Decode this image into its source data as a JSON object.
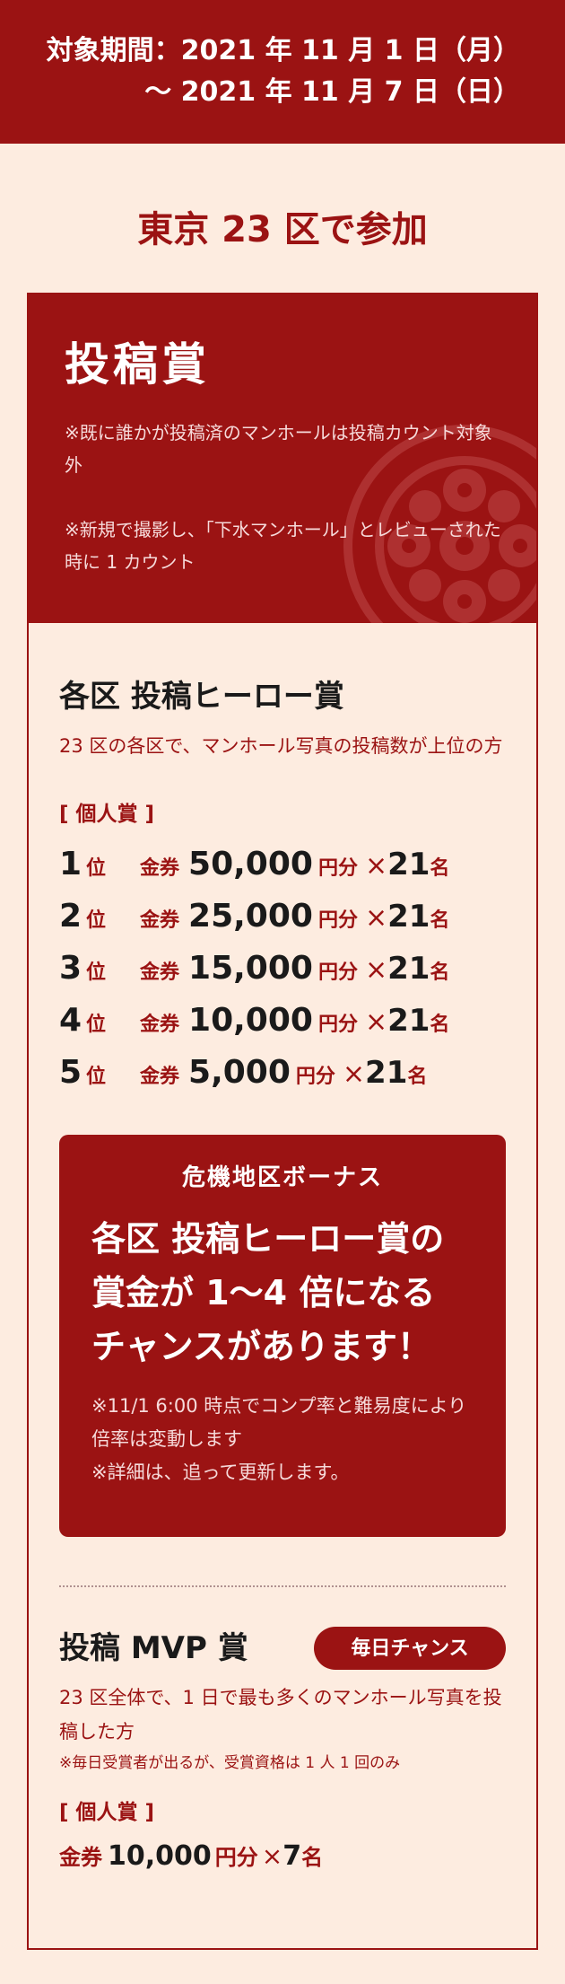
{
  "period": {
    "line1": "対象期間：2021 年 11 月 1 日（月）",
    "line2": "〜 2021 年 11 月 7 日（日）"
  },
  "region_title": "東京 23 区で参加",
  "card": {
    "title": "投稿賞",
    "notes": [
      "※既に誰かが投稿済のマンホールは投稿カウント対象外",
      "※新規で撮影し、「下水マンホール」とレビューされた時に 1 カウント"
    ]
  },
  "hero": {
    "title": "各区 投稿ヒーロー賞",
    "desc": "23 区の各区で、マンホール写真の投稿数が上位の方",
    "kind": "[ 個人賞 ]",
    "ranks": [
      {
        "num": "1",
        "pos": "位",
        "kin": "金券",
        "amount": "50,000",
        "unit": "円分",
        "x": "×",
        "count": "21",
        "mei": "名"
      },
      {
        "num": "2",
        "pos": "位",
        "kin": "金券",
        "amount": "25,000",
        "unit": "円分",
        "x": "×",
        "count": "21",
        "mei": "名"
      },
      {
        "num": "3",
        "pos": "位",
        "kin": "金券",
        "amount": "15,000",
        "unit": "円分",
        "x": "×",
        "count": "21",
        "mei": "名"
      },
      {
        "num": "4",
        "pos": "位",
        "kin": "金券",
        "amount": "10,000",
        "unit": "円分",
        "x": "×",
        "count": "21",
        "mei": "名"
      },
      {
        "num": "5",
        "pos": "位",
        "kin": "金券",
        "amount": "5,000",
        "unit": "円分",
        "x": "×",
        "count": "21",
        "mei": "名"
      }
    ]
  },
  "bonus": {
    "title": "危機地区ボーナス",
    "main": [
      "各区 投稿ヒーロー賞の",
      "賞金が 1〜4 倍になる",
      "チャンスがあります！"
    ],
    "notes": [
      "※11/1 6:00 時点でコンプ率と難易度により倍率は変動します",
      "※詳細は、追って更新します。"
    ]
  },
  "mvp": {
    "title": "投稿 MVP 賞",
    "badge": "毎日チャンス",
    "desc": "23 区全体で、1 日で最も多くのマンホール写真を投稿した方",
    "small": "※毎日受賞者が出るが、受賞資格は 1 人 1 回のみ",
    "kind": "[ 個人賞 ]",
    "prize": {
      "kin": "金券",
      "amount": "10,000",
      "unit": "円分",
      "x": "×",
      "count": "7",
      "mei": "名"
    }
  },
  "colors": {
    "accent": "#9b1313",
    "background": "#fdece0"
  }
}
